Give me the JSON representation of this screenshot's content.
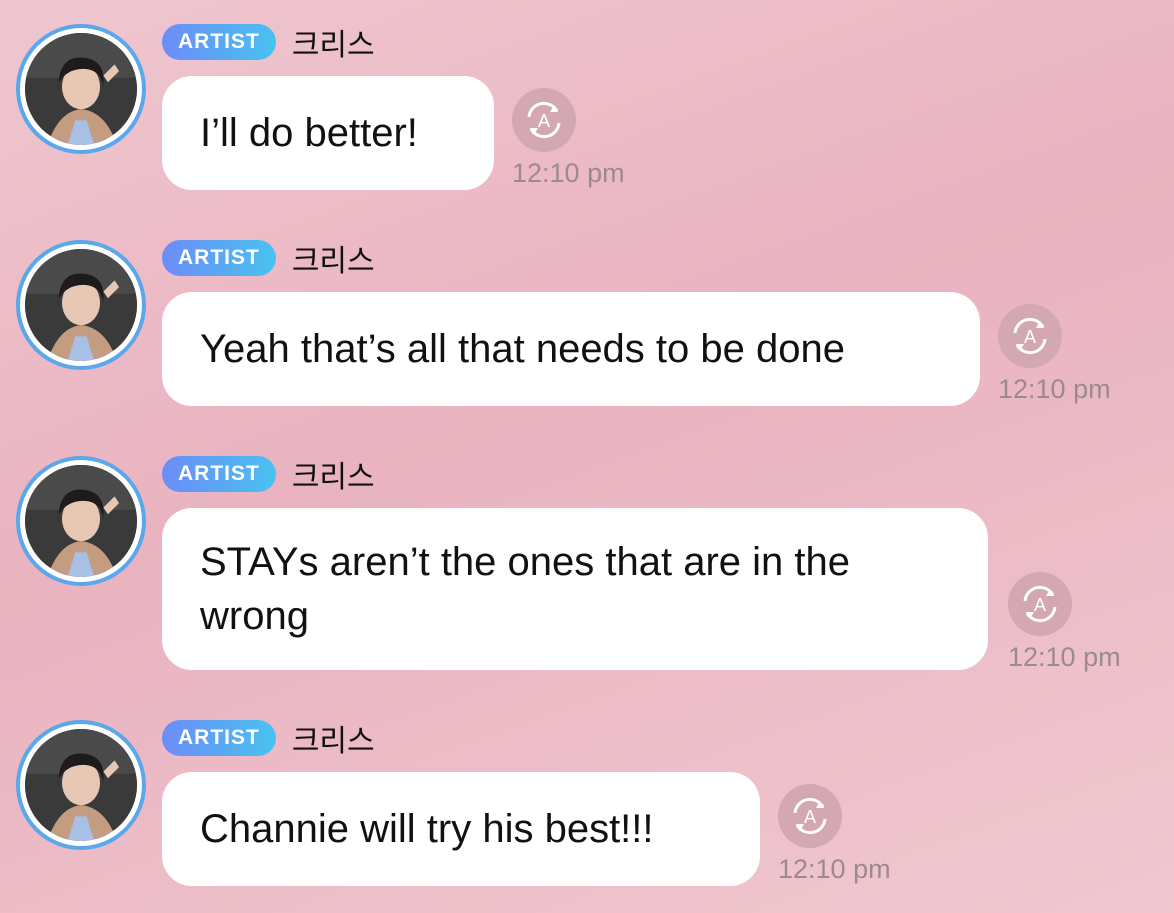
{
  "messages": [
    {
      "badge": "ARTIST",
      "username": "크리스",
      "text": "I’ll do better!",
      "time": "12:10 pm"
    },
    {
      "badge": "ARTIST",
      "username": "크리스",
      "text": "Yeah that’s all that needs to be done",
      "time": "12:10 pm"
    },
    {
      "badge": "ARTIST",
      "username": "크리스",
      "text": "STAYs aren’t the ones that are in the wrong",
      "time": "12:10 pm"
    },
    {
      "badge": "ARTIST",
      "username": "크리스",
      "text": "Channie will try his best!!!",
      "time": "12:10 pm"
    }
  ],
  "icons": {
    "translate": "translate-icon",
    "avatar": "avatar"
  },
  "colors": {
    "badge_start": "#6c8cf7",
    "badge_end": "#49c2f0",
    "avatar_ring": "#5aa7ee",
    "bubble": "#ffffff",
    "timestamp": "#9c8a8e"
  }
}
